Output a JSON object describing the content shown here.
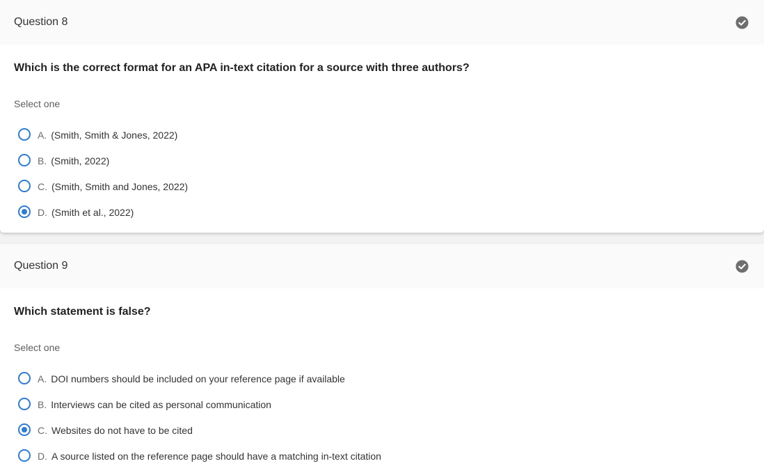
{
  "questions": [
    {
      "title": "Question 8",
      "status_icon": "check-circle-icon",
      "prompt": "Which is the correct format for an APA in-text citation for a source with three authors?",
      "instruction": "Select one",
      "selected": 3,
      "options": [
        {
          "letter": "A.",
          "text": "(Smith, Smith & Jones, 2022)"
        },
        {
          "letter": "B.",
          "text": "(Smith, 2022)"
        },
        {
          "letter": "C.",
          "text": "(Smith, Smith and Jones, 2022)"
        },
        {
          "letter": "D.",
          "text": "(Smith et al., 2022)"
        }
      ]
    },
    {
      "title": "Question 9",
      "status_icon": "check-circle-icon",
      "prompt": "Which statement is false?",
      "instruction": "Select one",
      "selected": 2,
      "options": [
        {
          "letter": "A.",
          "text": "DOI numbers should be included on your reference page if available"
        },
        {
          "letter": "B.",
          "text": "Interviews can be cited as personal communication"
        },
        {
          "letter": "C.",
          "text": "Websites do not have to be cited"
        },
        {
          "letter": "D.",
          "text": "A source listed on the reference page should have a matching in-text citation"
        }
      ]
    }
  ],
  "colors": {
    "radio_accent": "#2d7cd6",
    "check_icon": "#6e6e6e"
  }
}
